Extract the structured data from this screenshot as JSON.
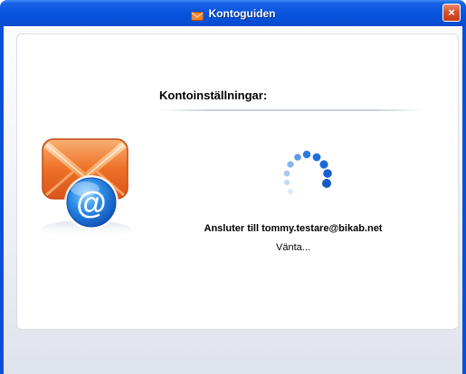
{
  "window": {
    "title": "Kontoguiden",
    "close_glyph": "×"
  },
  "dialog": {
    "heading": "Kontoinställningar:",
    "status_main": "Ansluter till tommy.testare@bikab.net",
    "status_sub": "Vänta..."
  },
  "icons": {
    "title_icon": "envelope-icon",
    "illustration": "email-envelope-at-icon",
    "spinner": "loading-spinner-icon"
  },
  "colors": {
    "titlebar": "#0a56e0",
    "envelope": "#e9641e",
    "at_badge": "#1d73d9",
    "spinner": "#1d6ee0"
  }
}
